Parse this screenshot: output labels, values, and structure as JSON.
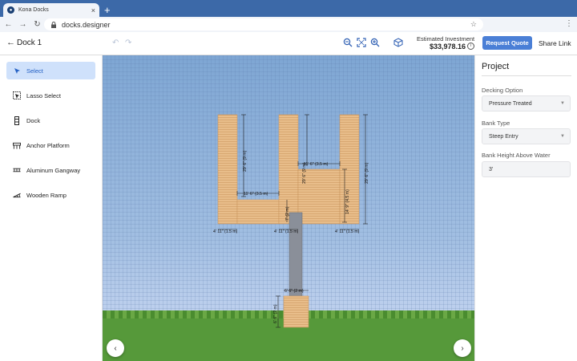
{
  "browser": {
    "tab_title": "Kona Docks",
    "url": "docks.designer",
    "new_tab": "+",
    "close": "×"
  },
  "header": {
    "title": "Dock 1",
    "estimated_label": "Estimated Investment",
    "estimated_value": "$33,978.16",
    "request_quote": "Request Quote",
    "share_link": "Share Link"
  },
  "tools": [
    {
      "label": "Select",
      "icon": "pointer-icon"
    },
    {
      "label": "Lasso Select",
      "icon": "lasso-icon"
    },
    {
      "label": "Dock",
      "icon": "dock-icon"
    },
    {
      "label": "Anchor Platform",
      "icon": "anchor-platform-icon"
    },
    {
      "label": "Aluminum Gangway",
      "icon": "gangway-icon"
    },
    {
      "label": "Wooden Ramp",
      "icon": "ramp-icon"
    }
  ],
  "panel": {
    "title": "Project",
    "decking_label": "Decking Option",
    "decking_value": "Pressure Treated",
    "bank_type_label": "Bank Type",
    "bank_type_value": "Steep Entry",
    "bank_height_label": "Bank Height Above Water",
    "bank_height_value": "3'"
  },
  "dimensions": {
    "left_leg_height": "29' 6\" (9 m)",
    "left_connector": "11' 6\" (3.5 m)",
    "center_leg_height": "29' 6\" (9 m)",
    "center_lower": "7' (2 m)",
    "right_connector": "11' 6\" (3.5 m)",
    "right_inner_height": "14' 9\" (4.5 m)",
    "right_leg_height": "29' 6\" (9 m)",
    "width_left": "4' 11\" (1.5 m)",
    "width_center": "4' 11\" (1.5 m)",
    "width_right": "4' 11\" (1.5 m)",
    "platform_width": "6' 6\" (2 m)",
    "platform_height": "6' 6\" (2 m)"
  },
  "colors": {
    "wood": "#e8bd8a",
    "wood_line": "#c9935b",
    "gangway": "#8a8f99",
    "accent": "#4a7fd6"
  }
}
